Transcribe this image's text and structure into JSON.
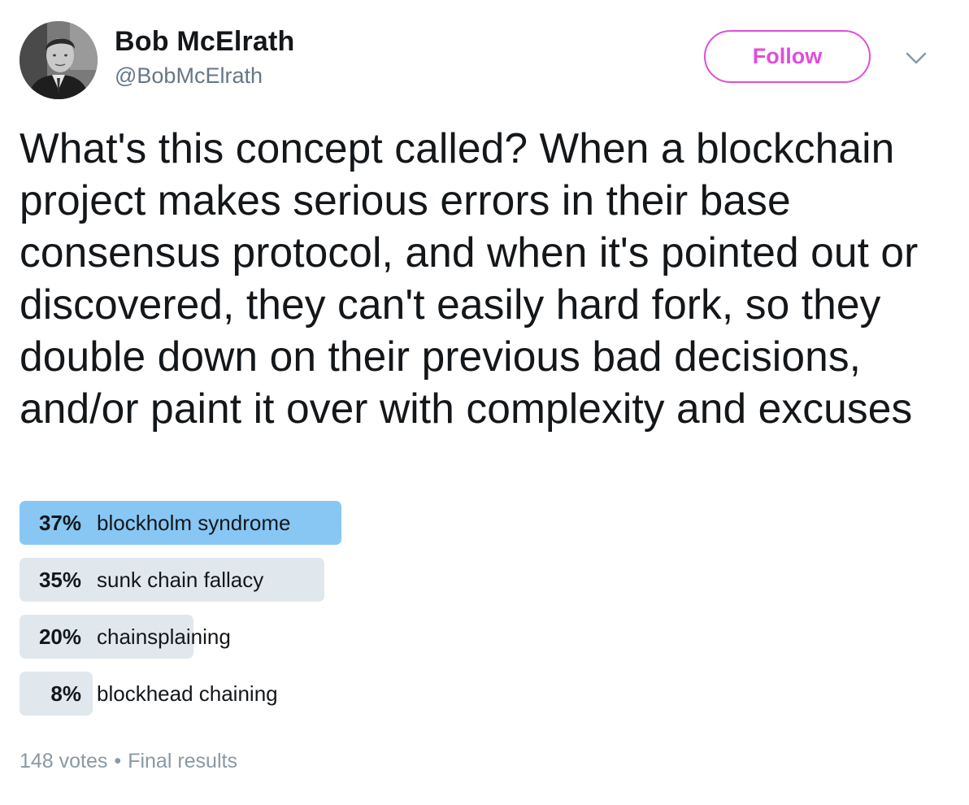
{
  "user": {
    "display_name": "Bob McElrath",
    "handle": "@BobMcElrath",
    "avatar_icon": "person-photo-avatar"
  },
  "actions": {
    "follow_label": "Follow",
    "follow_color": "#e04ddb",
    "more_icon": "chevron-down-icon"
  },
  "tweet": {
    "text": "What's this concept called? When a blockchain project makes serious errors in their base consensus protocol, and when it's pointed out or discovered, they can't easily hard fork, so they double down on their previous bad decisions, and/or paint it over with complexity and excuses"
  },
  "poll": {
    "options": [
      {
        "percent": 37,
        "percent_label": "37%",
        "label": "blockholm syndrome",
        "winner": true
      },
      {
        "percent": 35,
        "percent_label": "35%",
        "label": "sunk chain fallacy",
        "winner": false
      },
      {
        "percent": 20,
        "percent_label": "20%",
        "label": "chainsplaining",
        "winner": false
      },
      {
        "percent": 8,
        "percent_label": "8%",
        "label": "blockhead chaining",
        "winner": false
      }
    ],
    "votes": "148 votes",
    "separator": "•",
    "status": "Final results",
    "colors": {
      "winner_bar": "#88c7f4",
      "other_bar": "#e1e8ed"
    }
  }
}
